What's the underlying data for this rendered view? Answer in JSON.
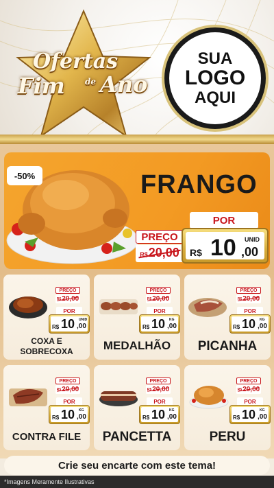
{
  "header": {
    "brand_line1": "Ofertas",
    "brand_line2": "Fim",
    "brand_de": "de",
    "brand_line3": "Ano",
    "logo_line1": "SUA",
    "logo_line2": "LOGO",
    "logo_line3": "AQUI"
  },
  "featured": {
    "discount": "-50%",
    "name": "FRANGO",
    "preco_label": "PREÇO",
    "old_currency": "R$",
    "old_price": "20,00",
    "por_label": "POR",
    "currency": "R$",
    "price_int": "10",
    "price_dec": ",00",
    "unit": "UNID"
  },
  "products": [
    {
      "name": "COXA E SOBRECOXA",
      "preco_label": "PREÇO",
      "old_currency": "R$",
      "old_price": "20,00",
      "por_label": "POR",
      "currency": "R$",
      "price_int": "10",
      "price_dec": ",00",
      "unit": "UNID"
    },
    {
      "name": "MEDALHÃO",
      "preco_label": "PREÇO",
      "old_currency": "R$",
      "old_price": "20,00",
      "por_label": "POR",
      "currency": "R$",
      "price_int": "10",
      "price_dec": ",00",
      "unit": "KG"
    },
    {
      "name": "PICANHA",
      "preco_label": "PREÇO",
      "old_currency": "R$",
      "old_price": "20,00",
      "por_label": "POR",
      "currency": "R$",
      "price_int": "10",
      "price_dec": ",00",
      "unit": "KG"
    },
    {
      "name": "CONTRA FILE",
      "preco_label": "PREÇO",
      "old_currency": "R$",
      "old_price": "20,00",
      "por_label": "POR",
      "currency": "R$",
      "price_int": "10",
      "price_dec": ",00",
      "unit": "KG"
    },
    {
      "name": "PANCETTA",
      "preco_label": "PREÇO",
      "old_currency": "R$",
      "old_price": "20,00",
      "por_label": "POR",
      "currency": "R$",
      "price_int": "10",
      "price_dec": ",00",
      "unit": "KG"
    },
    {
      "name": "PERU",
      "preco_label": "PREÇO",
      "old_currency": "R$",
      "old_price": "20,00",
      "por_label": "POR",
      "currency": "R$",
      "price_int": "10",
      "price_dec": ",00",
      "unit": "KG"
    }
  ],
  "cta": "Crie seu encarte com este tema!",
  "footer": "*Imagens Meramente Ilustrativas",
  "colors": {
    "accent_red": "#c8151b",
    "featured_orange": "#f39a23",
    "gold": "#d7ad3c"
  }
}
